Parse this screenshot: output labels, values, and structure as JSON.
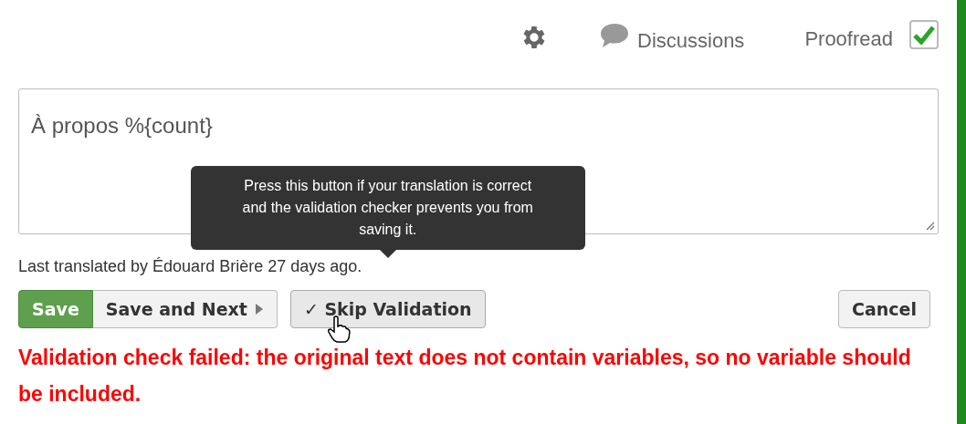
{
  "toolbar": {
    "discussions": "Discussions",
    "proofread": {
      "label": "Proofread",
      "checked": true
    }
  },
  "editor": {
    "value": "À propos %{count}"
  },
  "last_translated": "Last translated by Édouard Brière 27 days ago.",
  "buttons": [
    {
      "kind": "primary",
      "label": "Save"
    },
    {
      "kind": "next",
      "label": "Save and Next"
    },
    {
      "kind": "skip",
      "label": "✓ Skip Validation"
    },
    {
      "kind": "cancel",
      "label": "Cancel"
    }
  ],
  "tooltip": "Press this button if your translation is correct and the validation checker prevents you from saving it.",
  "error": "Validation check failed: the original text does not contain variables, so no variable should be included."
}
